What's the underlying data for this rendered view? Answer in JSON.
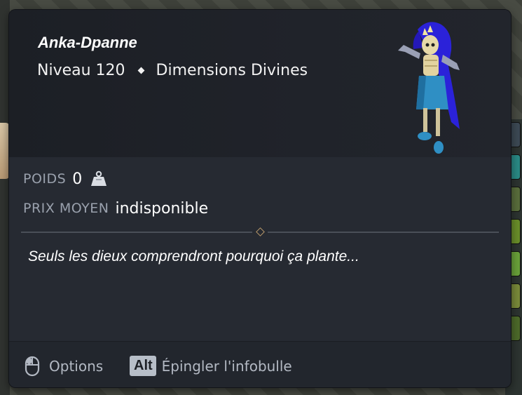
{
  "item": {
    "name": "Anka-Dpanne",
    "level": "Niveau 120",
    "category": "Dimensions Divines"
  },
  "stats": {
    "weight_label": "POIDS",
    "weight_value": "0",
    "weight_icon": "weight-icon",
    "price_label": "PRIX MOYEN",
    "price_value": "indisponible"
  },
  "description": "Seuls les dieux comprendront pourquoi ça plante...",
  "footer": {
    "options_icon": "mouse-icon",
    "options_label": "Options",
    "pin_key": "Alt",
    "pin_label": "Épingler l'infobulle"
  },
  "colors": {
    "panel": "#262a32",
    "header": "#1f2228",
    "label": "#9aa1ad",
    "accent_gem": "#b8986a",
    "sprite_blue": "#2b22d9",
    "sprite_teal": "#2f8fc4"
  }
}
